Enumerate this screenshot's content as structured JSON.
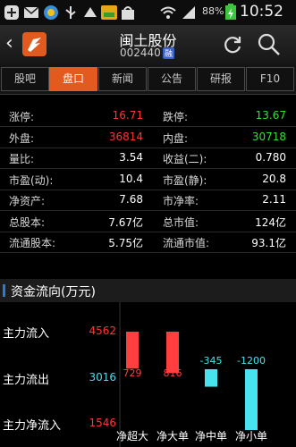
{
  "status_bar": {
    "battery": "88%",
    "time": "10:52"
  },
  "header": {
    "back_icon": "chevron-left-icon",
    "stock_name": "闽土股份",
    "stock_code": "002440",
    "market_badge": "融",
    "refresh_icon": "refresh-icon",
    "search_icon": "search-icon"
  },
  "tabs": [
    "股吧",
    "盘口",
    "新闻",
    "公告",
    "研报",
    "F10"
  ],
  "active_tab": 1,
  "quote_rows": [
    {
      "l1": "涨停:",
      "v1": "16.71",
      "c1": "red",
      "l2": "跌停:",
      "v2": "13.67",
      "c2": "green"
    },
    {
      "l1": "外盘:",
      "v1": "36814",
      "c1": "red",
      "l2": "内盘:",
      "v2": "30718",
      "c2": "green"
    },
    {
      "l1": "量比:",
      "v1": "3.54",
      "c1": "white",
      "l2": "收益(二):",
      "v2": "0.780",
      "c2": "white"
    },
    {
      "l1": "市盈(动):",
      "v1": "10.4",
      "c1": "white",
      "l2": "市盈(静):",
      "v2": "20.8",
      "c2": "white"
    },
    {
      "l1": "净资产:",
      "v1": "7.68",
      "c1": "white",
      "l2": "市净率:",
      "v2": "2.11",
      "c2": "white"
    },
    {
      "l1": "总股本:",
      "v1": "7.67亿",
      "c1": "white",
      "l2": "总市值:",
      "v2": "124亿",
      "c2": "white"
    },
    {
      "l1": "流通股本:",
      "v1": "5.75亿",
      "c1": "white",
      "l2": "流通市值:",
      "v2": "93.1亿",
      "c2": "white"
    }
  ],
  "section_title": "资金流向(万元)",
  "flows": [
    {
      "label": "主力流入",
      "value": "4562",
      "color": "#ff3434"
    },
    {
      "label": "主力流出",
      "value": "3016",
      "color": "#4fd9e8"
    },
    {
      "label": "主力净流入",
      "value": "1546",
      "color": "#ff3434"
    }
  ],
  "chart_data": {
    "type": "bar",
    "categories": [
      "净超大",
      "净大单",
      "净中单",
      "净小单"
    ],
    "values": [
      729,
      816,
      -345,
      -1200
    ],
    "value_labels": [
      "729",
      "816",
      "-345",
      "-1200"
    ],
    "colors": {
      "positive": "#ff3f3f",
      "negative": "#47e3ef"
    }
  }
}
